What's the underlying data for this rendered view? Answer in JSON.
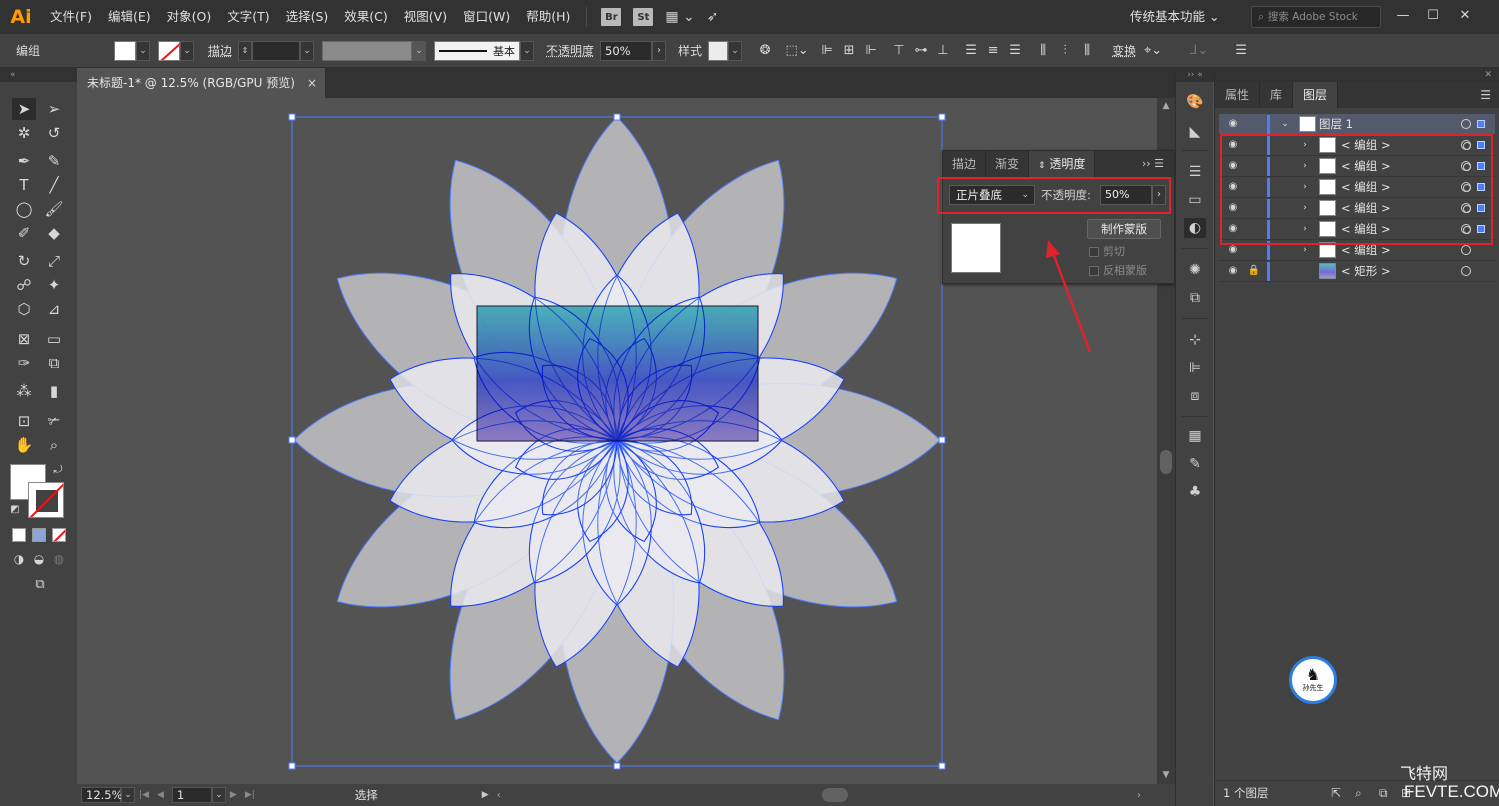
{
  "menubar": {
    "logo": "Ai",
    "menus": [
      "文件(F)",
      "编辑(E)",
      "对象(O)",
      "文字(T)",
      "选择(S)",
      "效果(C)",
      "视图(V)",
      "窗口(W)",
      "帮助(H)"
    ],
    "bridge_label": "Br",
    "stock_label": "St",
    "workspace": "传统基本功能",
    "search_placeholder": "搜索 Adobe Stock"
  },
  "controlbar": {
    "selection_type": "编组",
    "stroke_label": "描边",
    "stroke_profile": "基本",
    "opacity_label": "不透明度",
    "opacity_value": "50%",
    "style_label": "样式",
    "transform_label": "变换"
  },
  "document": {
    "tab_title": "未标题-1* @ 12.5% (RGB/GPU 预览)",
    "close": "×"
  },
  "statusbar": {
    "zoom": "12.5%",
    "artboard": "1",
    "tool": "选择"
  },
  "transparency_panel": {
    "tabs": [
      "描边",
      "渐变",
      "透明度"
    ],
    "active_tab": "透明度",
    "blend_mode": "正片叠底",
    "opacity_label": "不透明度:",
    "opacity_value": "50%",
    "make_mask": "制作蒙版",
    "clip": "剪切",
    "invert_mask": "反相蒙版"
  },
  "layers_panel": {
    "tabs": [
      "属性",
      "库",
      "图层"
    ],
    "active_tab": "图层",
    "layer_name": "图层 1",
    "sublayers": [
      {
        "name": "< 编组 >",
        "highlighted": true
      },
      {
        "name": "< 编组 >",
        "highlighted": true
      },
      {
        "name": "< 编组 >",
        "highlighted": true
      },
      {
        "name": "< 编组 >",
        "highlighted": true
      },
      {
        "name": "< 编组 >",
        "highlighted": true
      },
      {
        "name": "< 编组 >",
        "highlighted": false
      },
      {
        "name": "< 矩形 >",
        "highlighted": false
      }
    ],
    "layer_count": "1 个图层"
  },
  "watermark": {
    "site": "飞特网",
    "url": "FEVTE.COM",
    "logo_text": "孙先生"
  },
  "colors": {
    "annotation_red": "#e0222a",
    "selection_blue": "#4f7cff",
    "petal_outer": "#b3b3b5",
    "petal_inner": "#e9e9ee"
  }
}
